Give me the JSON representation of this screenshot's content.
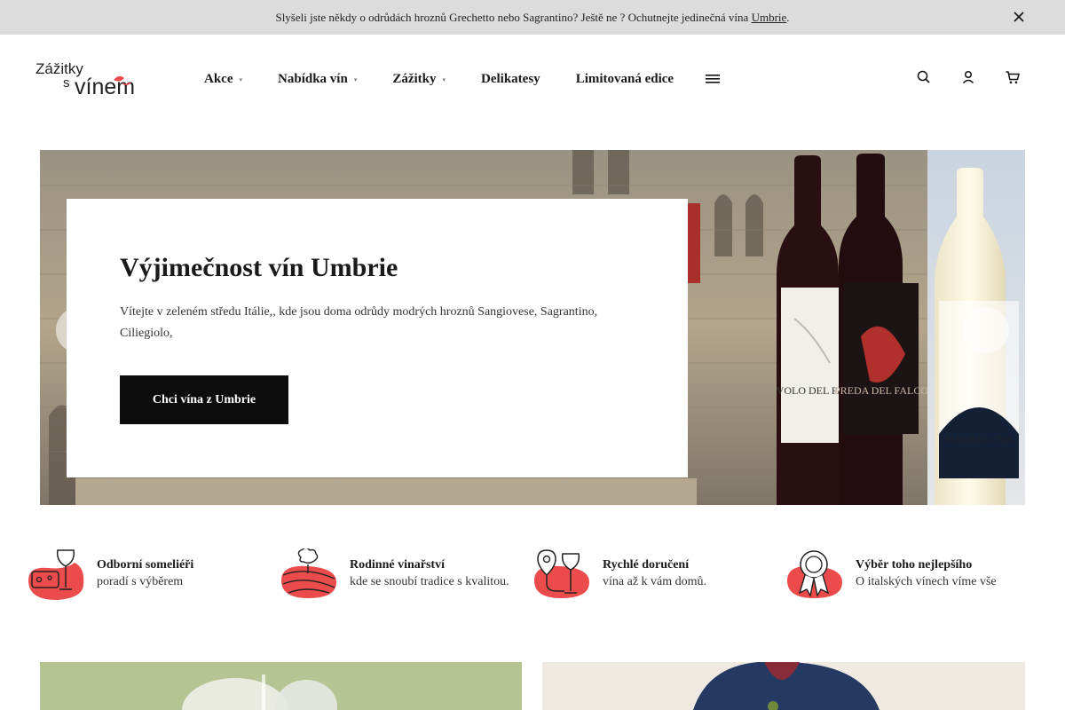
{
  "announcement": {
    "text": "Slyšeli jste někdy o odrůdách hroznů Grechetto nebo Sagrantino? Ještě ne ? Ochutnejte jedinečná vína ",
    "link": "Umbrie",
    "after": "."
  },
  "logo": {
    "line1": "Zážitky",
    "line2": "s",
    "line3": "vínem"
  },
  "nav": {
    "items": [
      {
        "label": "Akce",
        "caret": true
      },
      {
        "label": "Nabídka vín",
        "caret": true
      },
      {
        "label": "Zážitky",
        "caret": true
      },
      {
        "label": "Delikatesy",
        "caret": false
      },
      {
        "label": "Limitovaná edice",
        "caret": false
      }
    ],
    "caret_glyph": "▾"
  },
  "hero": {
    "title": "Výjimečnost vín Umbrie",
    "text": "Vítejte v zeleném středu Itálie,, kde jsou doma odrůdy modrých hroznů Sangiovese, Sagrantino, Ciliegiolo,",
    "button": "Chci vína z Umbrie",
    "bottles": [
      "VOLO DEL FALCO",
      "PREDA DEL FALCO",
      "MADRELUNA"
    ]
  },
  "features": [
    {
      "title": "Odborní someliéři",
      "subtitle": "poradí s výběrem",
      "icon": "sommelier-icon"
    },
    {
      "title": "Rodinné vinařství",
      "subtitle": "kde se snoubí tradice s kvalitou.",
      "icon": "vineyard-icon"
    },
    {
      "title": "Rychlé doručení",
      "subtitle": "vína až k vám domů.",
      "icon": "delivery-icon"
    },
    {
      "title": "Výběr toho nejlepšího",
      "subtitle": "O italských vínech víme vše",
      "icon": "award-icon"
    }
  ],
  "colors": {
    "accent": "#ec4b4b",
    "button": "#0d0d0d",
    "topbar": "#dcdcdc"
  }
}
